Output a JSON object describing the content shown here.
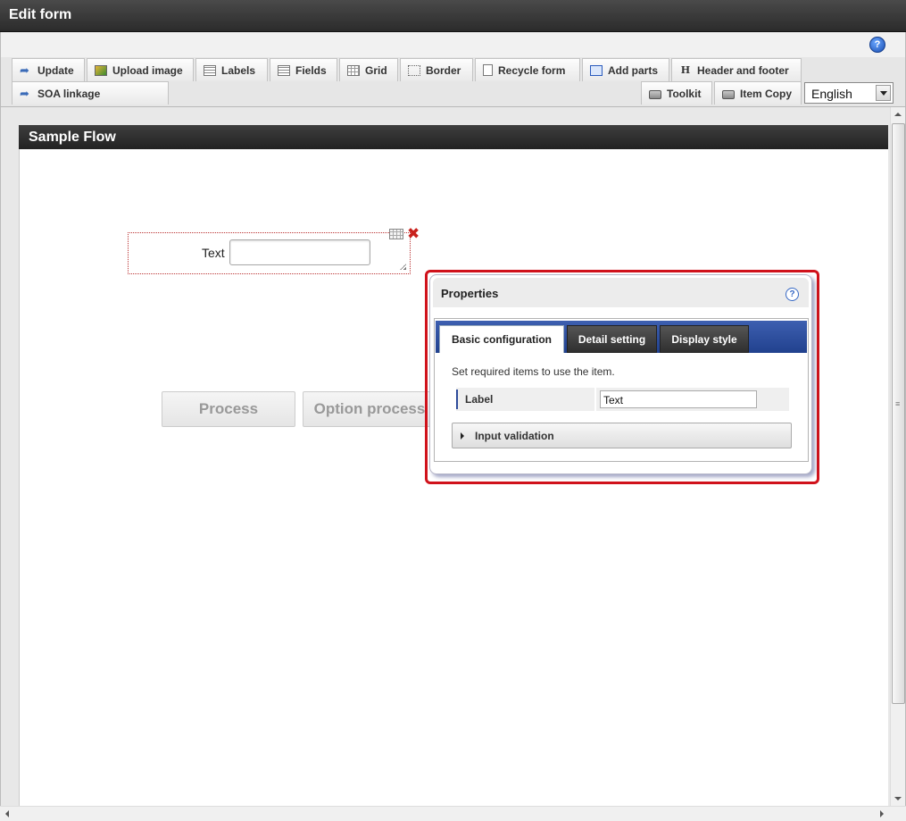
{
  "window": {
    "title": "Edit form"
  },
  "help": {
    "label": "?"
  },
  "toolbar": {
    "update": "Update",
    "upload_image": "Upload image",
    "labels": "Labels",
    "fields": "Fields",
    "grid": "Grid",
    "border": "Border",
    "recycle_form": "Recycle form",
    "add_parts": "Add parts",
    "header_footer": "Header and footer",
    "soa_linkage": "SOA linkage",
    "toolkit": "Toolkit",
    "item_copy": "Item Copy",
    "language": "English"
  },
  "flow": {
    "title": "Sample Flow"
  },
  "form_field": {
    "label": "Text",
    "value": ""
  },
  "buttons": {
    "process": "Process",
    "option_process": "Option process"
  },
  "properties": {
    "title": "Properties",
    "help": "?",
    "tabs": [
      "Basic configuration",
      "Detail setting",
      "Display style"
    ],
    "active_tab": "Basic configuration",
    "description": "Set required items to use the item.",
    "label_row": {
      "label": "Label",
      "value": "Text"
    },
    "accordion": "Input validation"
  },
  "colors": {
    "highlight": "#d0121b",
    "tab_bar": "#2d4b9a",
    "header_dark": "#2b2b2b"
  }
}
